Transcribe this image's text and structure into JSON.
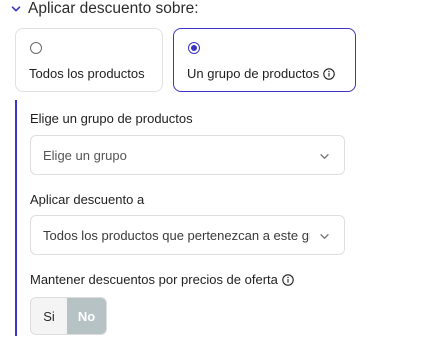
{
  "section": {
    "title": "Aplicar descuento sobre:",
    "chevron_icon": "chevron-down-icon"
  },
  "options": [
    {
      "label": "Todos los productos",
      "selected": false
    },
    {
      "label": "Un grupo de productos",
      "selected": true,
      "icon": "info-icon"
    }
  ],
  "fields": {
    "group": {
      "label": "Elige un grupo de productos",
      "placeholder": "Elige un grupo"
    },
    "apply": {
      "label": "Aplicar descuento a",
      "value": "Todos los productos que pertenezcan a este grupo"
    },
    "keep": {
      "label": "Mantener descuentos por precios de oferta",
      "icon": "info-icon",
      "toggle": {
        "yes_label": "Si",
        "no_label": "No",
        "selected": "No"
      }
    }
  },
  "colors": {
    "accent": "#3b35c4",
    "toggle_selected_bg": "#b7c2c4"
  }
}
